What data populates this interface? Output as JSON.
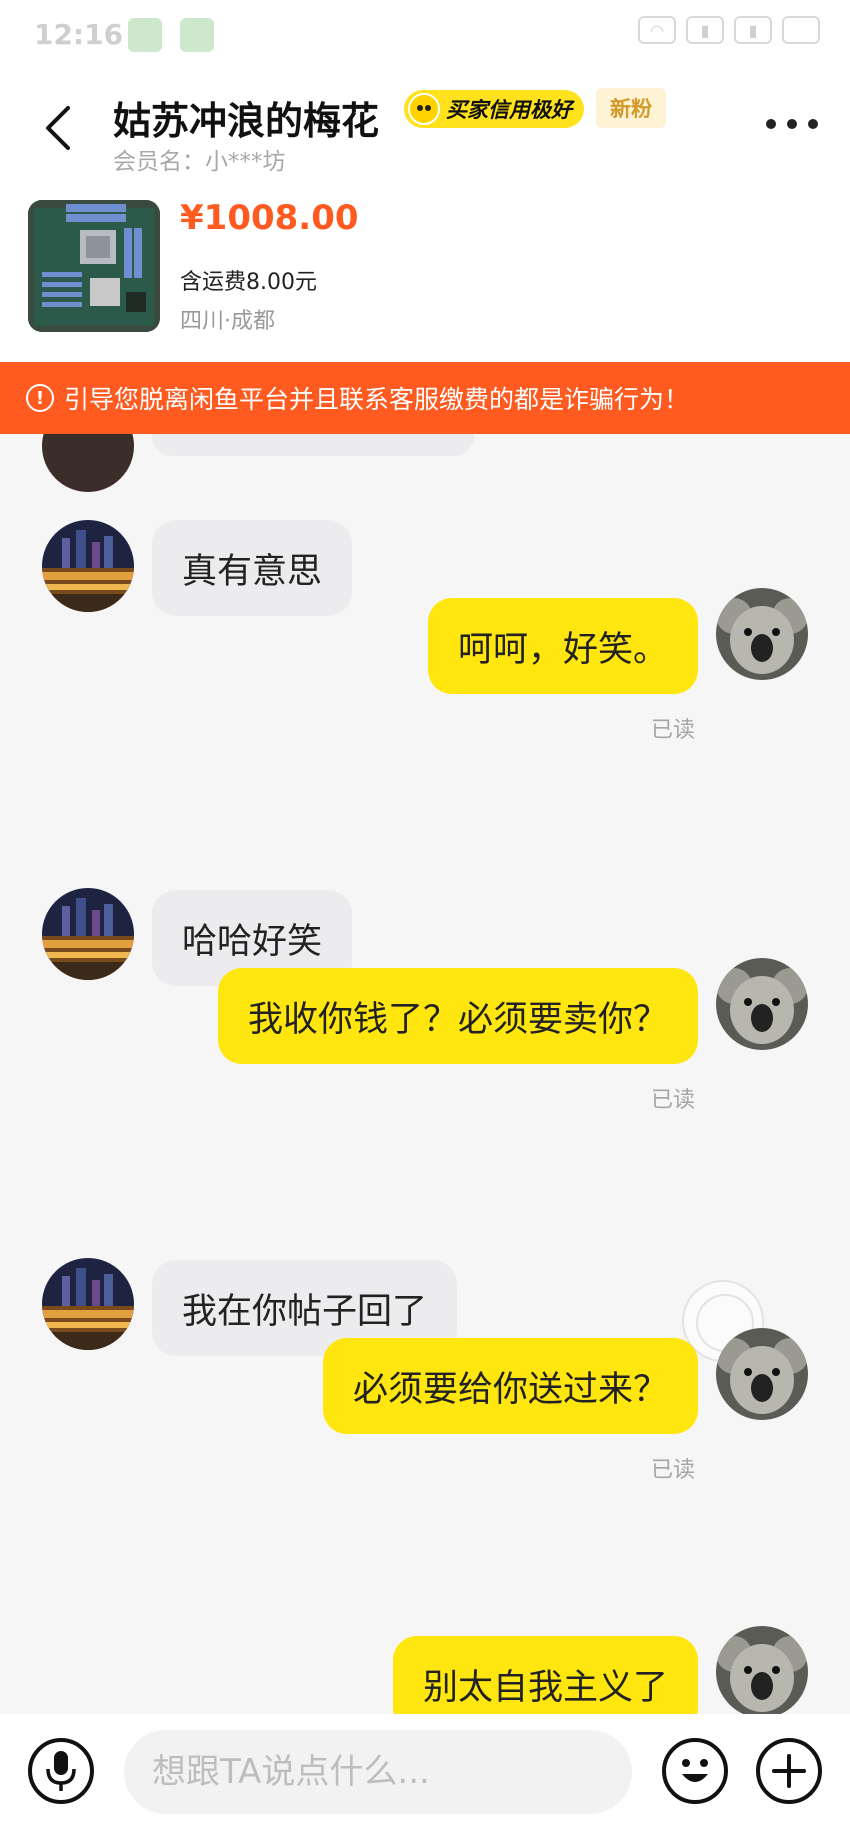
{
  "status_bar": {
    "time": "12:16"
  },
  "header": {
    "seller_name": "姑苏冲浪的梅花",
    "credit_badge": "买家信用极好",
    "new_fan_tag": "新粉",
    "member_name": "会员名：小***坊"
  },
  "product": {
    "price": "¥1008.00",
    "shipping": "含运费8.00元",
    "location": "四川·成都"
  },
  "warning": {
    "text": "引导您脱离闲鱼平台并且联系客服缴费的都是诈骗行为！"
  },
  "messages": [
    {
      "side": "in",
      "text": "真有意思"
    },
    {
      "side": "out",
      "text": "呵呵，好笑。",
      "status": "已读"
    },
    {
      "side": "in",
      "text": "哈哈好笑"
    },
    {
      "side": "out",
      "text": "我收你钱了？必须要卖你？",
      "status": "已读"
    },
    {
      "side": "in",
      "text": "我在你帖子回了"
    },
    {
      "side": "out",
      "text": "必须要给你送过来？",
      "status": "已读"
    },
    {
      "side": "out",
      "text": "别太自我主义了"
    }
  ],
  "input": {
    "placeholder": "想跟TA说点什么..."
  },
  "icons": {
    "back": "chevron-left-icon",
    "more": "more-dots-icon",
    "mic": "microphone-icon",
    "emoji": "emoji-icon",
    "plus": "plus-icon"
  },
  "colors": {
    "accent_yellow": "#ffe60f",
    "price_orange": "#ff5a1f",
    "warning_bg": "#ff5a1f",
    "incoming_bubble": "#ececef"
  }
}
